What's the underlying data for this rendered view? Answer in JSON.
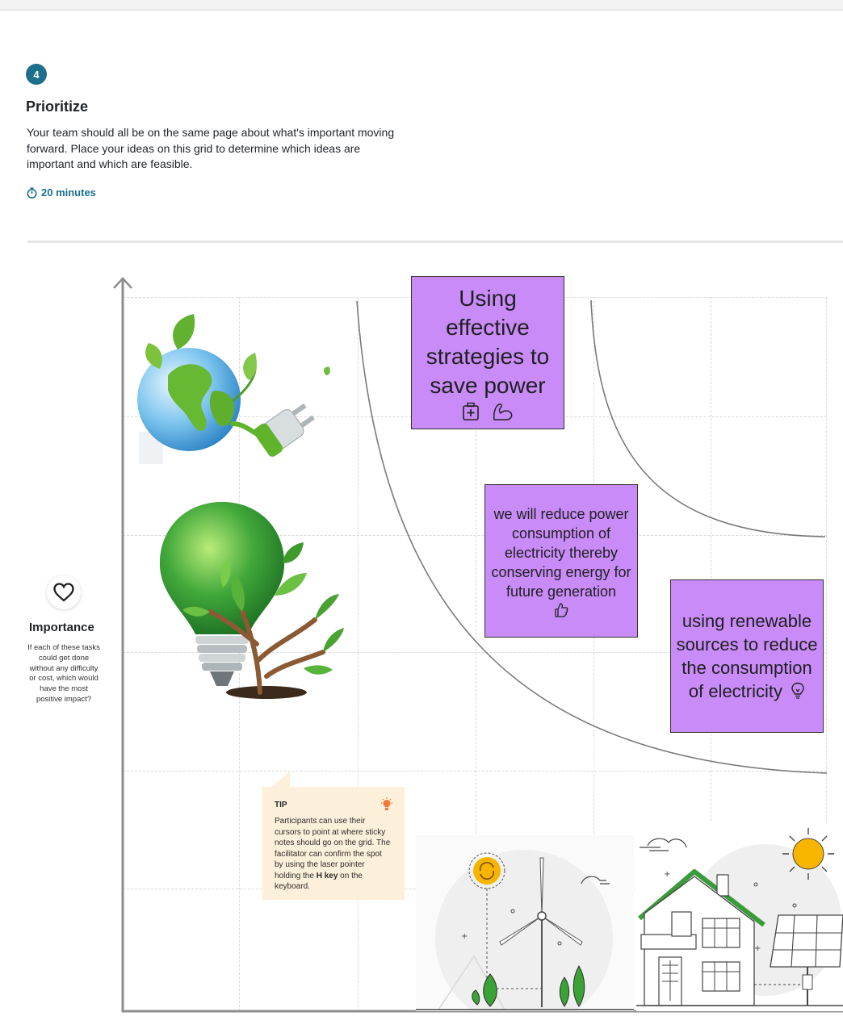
{
  "step": {
    "number": "4",
    "title": "Prioritize",
    "description": "Your team should all be on the same page about what's important moving forward. Place your ideas on this grid to determine which ideas are important and which are feasible.",
    "duration": "20 minutes"
  },
  "axis": {
    "y_label": "Importance",
    "y_description": "If each of these tasks could get done without any difficulty or cost, which would have the most positive impact?"
  },
  "stickies": [
    {
      "text": "Using effective strategies to save power",
      "icons": [
        "first-aid-kit-icon",
        "flexed-arm-icon"
      ]
    },
    {
      "text": "we will reduce power consumption of electricity thereby conserving energy for future generation",
      "icons": [
        "thumbs-up-icon"
      ]
    },
    {
      "text": "using renewable sources to reduce the consumption of electricity",
      "icons": [
        "lightbulb-icon"
      ]
    }
  ],
  "tip": {
    "title": "TIP",
    "body_before": "Participants can use their cursors to point at where sticky notes should go on the grid. The facilitator can confirm the spot by using the laser pointer holding the ",
    "body_key": "H key",
    "body_after": " on the keyboard."
  },
  "colors": {
    "accent": "#1d6f8c",
    "sticky": "#c88bf7",
    "tip_bg": "#fdf0da",
    "tip_icon": "#f07a3a",
    "leaf_green": "#3aa335",
    "house_roof": "#3a9b3a",
    "sun": "#f7b500"
  },
  "images": [
    "earth-plug-image",
    "green-bulb-tree-image",
    "wind-turbine-image",
    "solar-house-image"
  ]
}
